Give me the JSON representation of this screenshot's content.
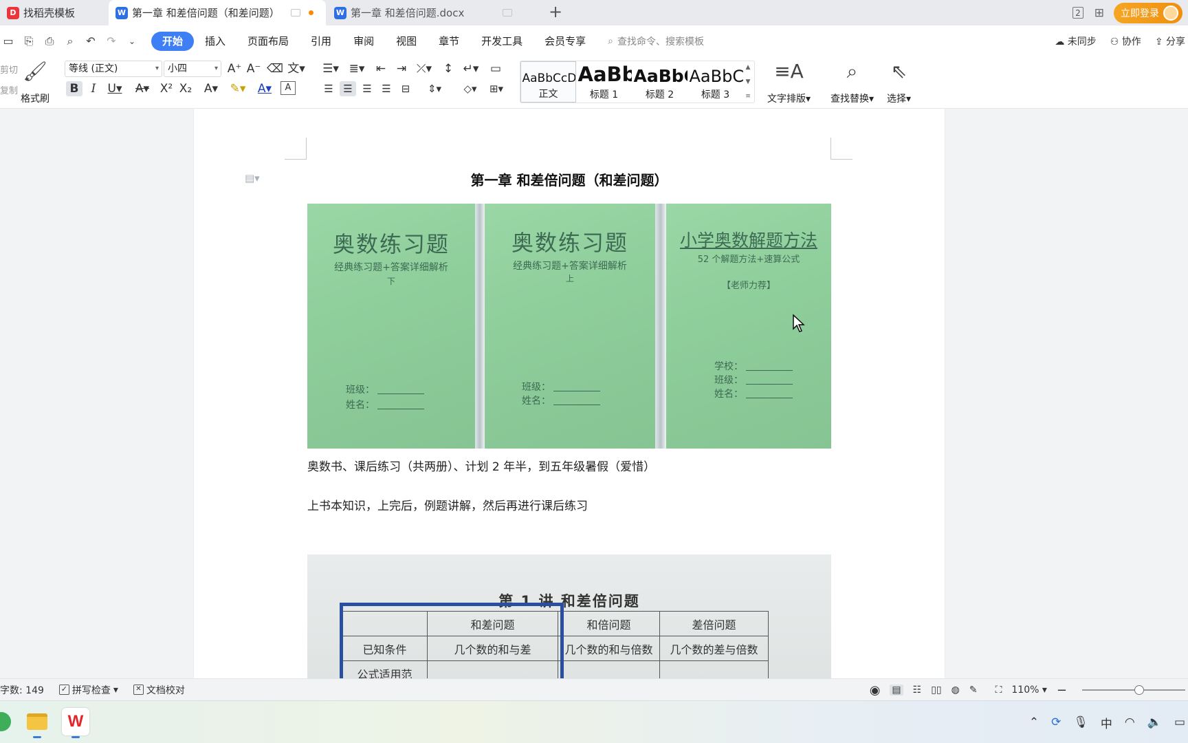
{
  "tabs": [
    {
      "label": "找稻壳模板",
      "icon": "docer-icon"
    },
    {
      "label": "第一章 和差倍问题（和差问题）",
      "icon": "wps-writer-icon"
    },
    {
      "label": "第一章 和差倍问题.docx",
      "icon": "wps-writer-icon"
    }
  ],
  "titlebar": {
    "page_indicator": "2",
    "login_label": "立即登录"
  },
  "menu": {
    "items": [
      "开始",
      "插入",
      "页面布局",
      "引用",
      "审阅",
      "视图",
      "章节",
      "开发工具",
      "会员专享"
    ],
    "active": "开始",
    "search_placeholder": "查找命令、搜索模板",
    "right": {
      "sync": "未同步",
      "collab": "协作",
      "share": "分享"
    }
  },
  "ribbon": {
    "cut_label": "剪切",
    "copy_label": "复制",
    "format_painter_label": "格式刷",
    "font_name": "等线 (正文)",
    "font_size": "小四",
    "styles": [
      {
        "preview": "AaBbCcDd",
        "name": "正文"
      },
      {
        "preview": "AaBb",
        "name": "标题 1"
      },
      {
        "preview": "AaBbC",
        "name": "标题 2"
      },
      {
        "preview": "AaBbC",
        "name": "标题 3"
      }
    ],
    "text_layout_label": "文字排版",
    "find_replace_label": "查找替换",
    "select_label": "选择"
  },
  "document": {
    "title": "第一章  和差倍问题（和差问题）",
    "books": [
      {
        "title": "奥数练习题",
        "subtitle": "经典练习题+答案详细解析",
        "volume": "下",
        "fields": [
          "班级：",
          "姓名："
        ]
      },
      {
        "title": "奥数练习题",
        "subtitle": "经典练习题+答案详细解析",
        "volume": "上",
        "fields": [
          "班级：",
          "姓名："
        ]
      },
      {
        "title": "小学奥数解题方法",
        "subtitle": "52 个解题方法+速算公式",
        "volume": "【老师力荐】",
        "fields": [
          "学校：",
          "班级：",
          "姓名："
        ]
      }
    ],
    "paragraph1": "奥数书、课后练习（共两册）、计划 2 年半，到五年级暑假（爱惜）",
    "paragraph2": "上书本知识，上完后，例题讲解，然后再进行课后练习",
    "photo2": {
      "heading": "第 1 讲   和差倍问题",
      "header_row": [
        "",
        "和差问题",
        "和倍问题",
        "差倍问题"
      ],
      "row1": [
        "已知条件",
        "几个数的和与差",
        "几个数的和与倍数",
        "几个数的差与倍数"
      ],
      "row2": [
        "公式适用范",
        "",
        "",
        ""
      ]
    }
  },
  "statusbar": {
    "word_count": "字数: 149",
    "spell_check": "拼写检查",
    "doc_proof": "文档校对",
    "zoom": "110%",
    "zoom_fraction": 0.55
  },
  "taskbar": {
    "ime": "中"
  }
}
